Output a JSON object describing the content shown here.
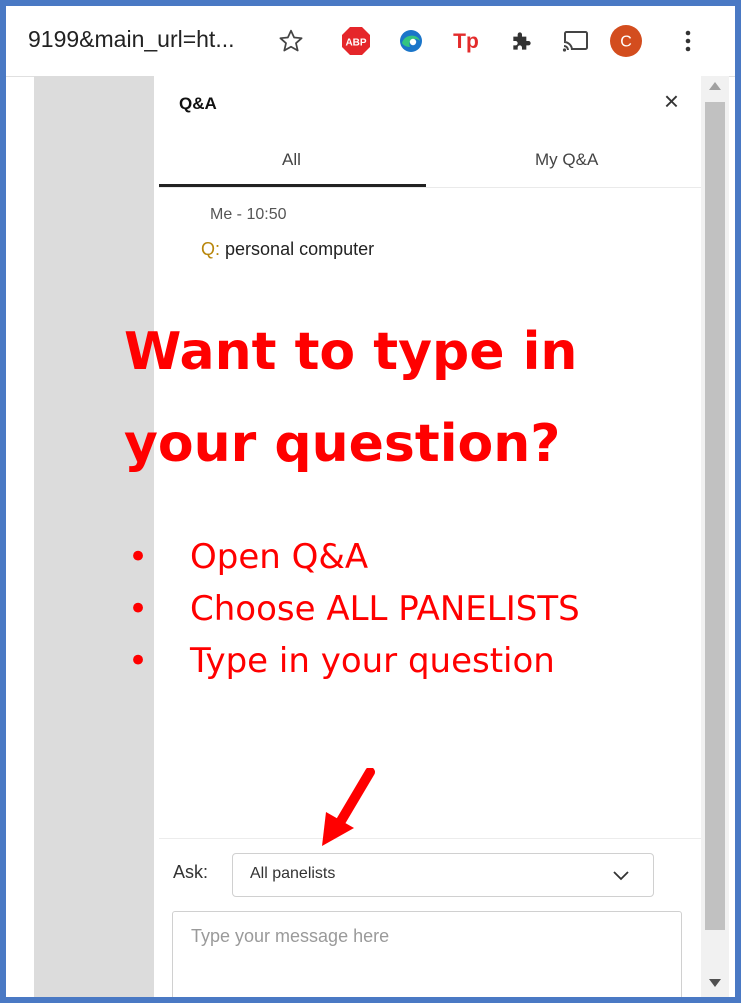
{
  "browser": {
    "url_text": "9199&main_url=ht...",
    "icons": [
      "star-icon",
      "adblock-icon",
      "edge-icon",
      "tp-icon",
      "puzzle-icon",
      "cast-icon",
      "avatar",
      "menu-icon"
    ],
    "avatar_letter": "C",
    "abp_text": "ABP",
    "tp_text": "Tp"
  },
  "panel": {
    "title": "Q&A",
    "close_symbol": "×",
    "tabs": [
      "All",
      "My Q&A"
    ],
    "active_tab": "All",
    "messages": [
      {
        "meta": "Me - 10:50",
        "prefix": "Q:",
        "text": "personal computer"
      }
    ],
    "ask_label": "Ask:",
    "ask_selected": "All panelists",
    "message_placeholder": "Type your message here"
  },
  "overlay": {
    "title_line1": "Want to type in",
    "title_line2": "your question?",
    "bullets": [
      "Open Q&A",
      "Choose ALL PANELISTS",
      "Type in your question"
    ],
    "color": "#ff0000"
  }
}
